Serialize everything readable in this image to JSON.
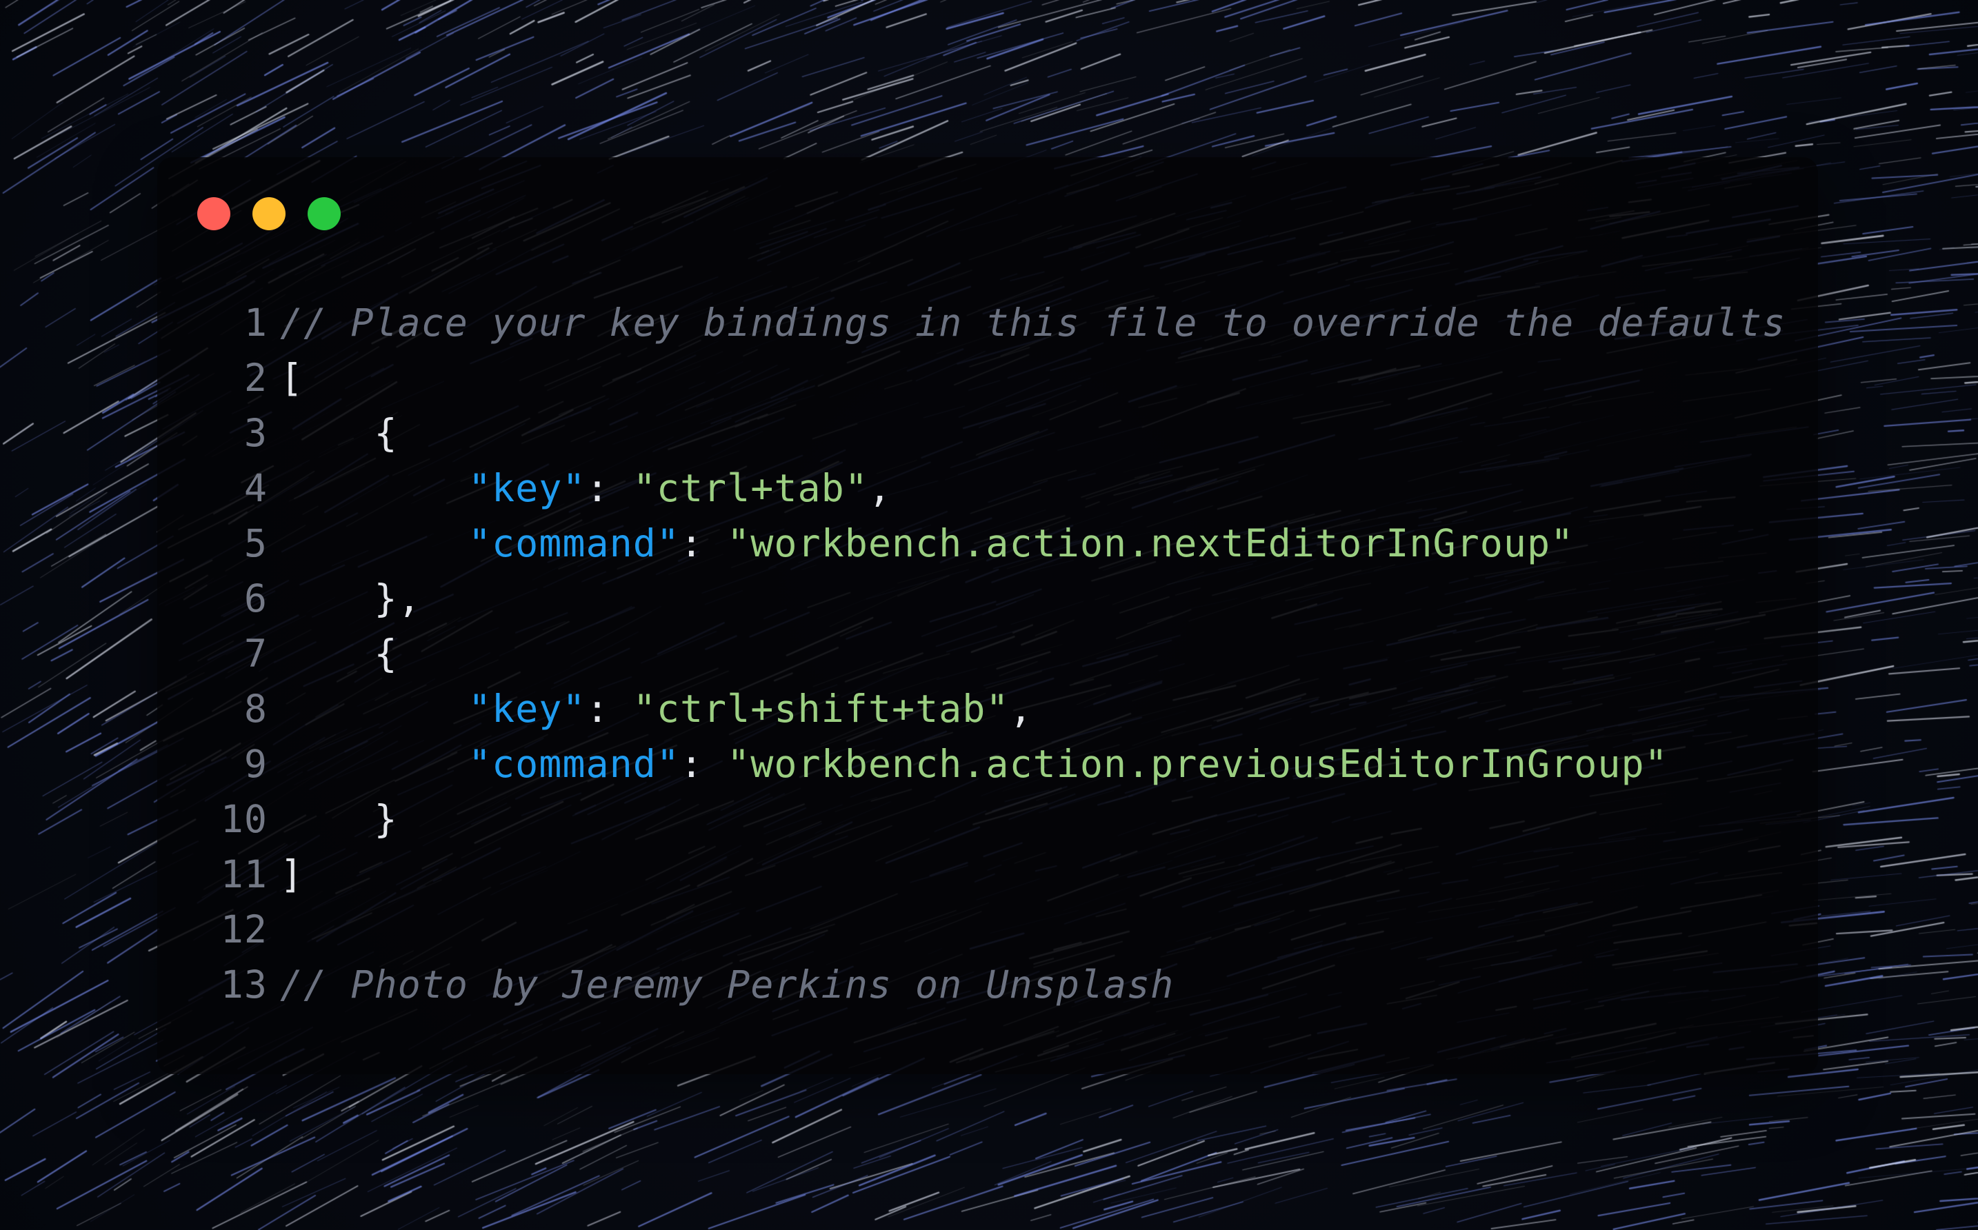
{
  "colors": {
    "traffic_close": "#ff5f57",
    "traffic_minimize": "#ffbd2e",
    "traffic_zoom": "#28c840",
    "comment": "#6b7180",
    "punctuation": "#e4e6eb",
    "json_key": "#1f9cf0",
    "json_string": "#9ccf82",
    "line_number": "#747986"
  },
  "window": {
    "traffic_lights": [
      "close",
      "minimize",
      "zoom"
    ]
  },
  "code": {
    "lines": [
      {
        "number": "1",
        "tokens": [
          {
            "t": "comment",
            "v": "// Place your key bindings in this file to override the defaults"
          }
        ]
      },
      {
        "number": "2",
        "tokens": [
          {
            "t": "punct",
            "v": "["
          }
        ]
      },
      {
        "number": "3",
        "tokens": [
          {
            "t": "punct",
            "v": "    {"
          }
        ]
      },
      {
        "number": "4",
        "tokens": [
          {
            "t": "punct",
            "v": "        "
          },
          {
            "t": "key",
            "v": "\"key\""
          },
          {
            "t": "punct",
            "v": ": "
          },
          {
            "t": "str",
            "v": "\"ctrl+tab\""
          },
          {
            "t": "punct",
            "v": ","
          }
        ]
      },
      {
        "number": "5",
        "tokens": [
          {
            "t": "punct",
            "v": "        "
          },
          {
            "t": "key",
            "v": "\"command\""
          },
          {
            "t": "punct",
            "v": ": "
          },
          {
            "t": "str",
            "v": "\"workbench.action.nextEditorInGroup\""
          }
        ]
      },
      {
        "number": "6",
        "tokens": [
          {
            "t": "punct",
            "v": "    },"
          }
        ]
      },
      {
        "number": "7",
        "tokens": [
          {
            "t": "punct",
            "v": "    {"
          }
        ]
      },
      {
        "number": "8",
        "tokens": [
          {
            "t": "punct",
            "v": "        "
          },
          {
            "t": "key",
            "v": "\"key\""
          },
          {
            "t": "punct",
            "v": ": "
          },
          {
            "t": "str",
            "v": "\"ctrl+shift+tab\""
          },
          {
            "t": "punct",
            "v": ","
          }
        ]
      },
      {
        "number": "9",
        "tokens": [
          {
            "t": "punct",
            "v": "        "
          },
          {
            "t": "key",
            "v": "\"command\""
          },
          {
            "t": "punct",
            "v": ": "
          },
          {
            "t": "str",
            "v": "\"workbench.action.previousEditorInGroup\""
          }
        ]
      },
      {
        "number": "10",
        "tokens": [
          {
            "t": "punct",
            "v": "    }"
          }
        ]
      },
      {
        "number": "11",
        "tokens": [
          {
            "t": "punct",
            "v": "]"
          }
        ]
      },
      {
        "number": "12",
        "tokens": []
      },
      {
        "number": "13",
        "tokens": [
          {
            "t": "comment",
            "v": "// Photo by Jeremy Perkins on Unsplash"
          }
        ]
      }
    ]
  }
}
